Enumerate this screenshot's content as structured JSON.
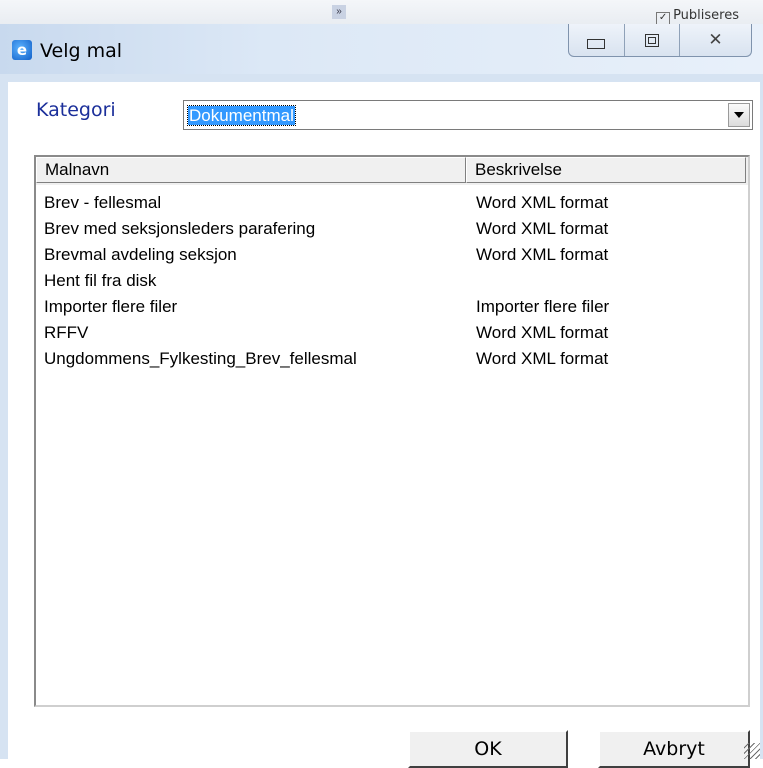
{
  "background": {
    "publish_label": "Publiseres",
    "publish_checked": true
  },
  "window": {
    "title": "Velg mal",
    "icon": "ie-app-icon"
  },
  "category": {
    "label": "Kategori",
    "value": "Dokumentmal"
  },
  "list": {
    "columns": [
      "Malnavn",
      "Beskrivelse"
    ],
    "rows": [
      {
        "name": "Brev - fellesmal",
        "desc": "Word XML format"
      },
      {
        "name": "Brev med seksjonsleders parafering",
        "desc": "Word XML format"
      },
      {
        "name": "Brevmal avdeling seksjon",
        "desc": "Word XML format"
      },
      {
        "name": "Hent fil fra disk",
        "desc": ""
      },
      {
        "name": "Importer flere filer",
        "desc": "Importer flere filer"
      },
      {
        "name": "RFFV",
        "desc": "Word XML format"
      },
      {
        "name": "Ungdommens_Fylkesting_Brev_fellesmal",
        "desc": "Word XML format"
      }
    ]
  },
  "buttons": {
    "ok": "OK",
    "cancel": "Avbryt"
  },
  "colors": {
    "label_blue": "#1b2f9a",
    "selection": "#3399ff"
  }
}
